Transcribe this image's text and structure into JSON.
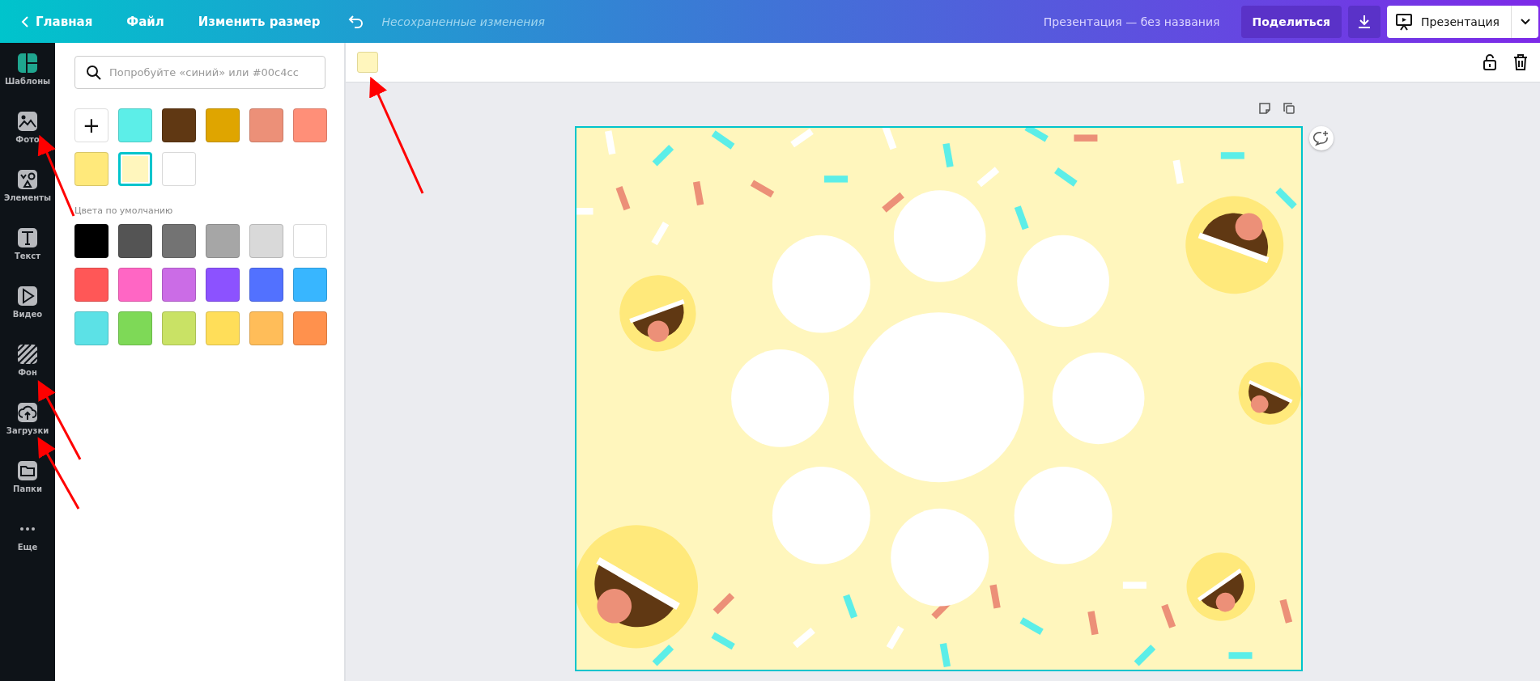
{
  "topbar": {
    "nav": [
      {
        "label": "Главная",
        "kind": "back"
      },
      {
        "label": "Файл",
        "kind": "menu"
      },
      {
        "label": "Изменить размер",
        "kind": "menu"
      }
    ],
    "status": "Несохраненные изменения",
    "title": "Презентация — без названия",
    "share": "Поделиться",
    "present": "Презентация"
  },
  "sidebar": {
    "items": [
      {
        "label": "Шаблоны",
        "kind": "templates"
      },
      {
        "label": "Фото",
        "kind": "photo"
      },
      {
        "label": "Элементы",
        "kind": "elements"
      },
      {
        "label": "Текст",
        "kind": "text"
      },
      {
        "label": "Видео",
        "kind": "video"
      },
      {
        "label": "Фон",
        "kind": "background"
      },
      {
        "label": "Загрузки",
        "kind": "uploads"
      },
      {
        "label": "Папки",
        "kind": "folders"
      },
      {
        "label": "Еще",
        "kind": "more"
      }
    ]
  },
  "panel": {
    "search": {
      "placeholder": "Попробуйте «синий» или #00c4cc"
    },
    "add_label": "+",
    "document_colors": [
      {
        "color": "#5ceee8",
        "selected": false
      },
      {
        "color": "#603813",
        "selected": false
      },
      {
        "color": "#dfa500",
        "selected": false
      },
      {
        "color": "#ec9078",
        "selected": false
      },
      {
        "color": "#ff8f78",
        "selected": false
      },
      {
        "color": "#ffe97b",
        "selected": false
      },
      {
        "color": "#fff6bd",
        "selected": true
      },
      {
        "color": "#ffffff",
        "selected": false
      }
    ],
    "default_title": "Цвета по умолчанию",
    "default_colors": [
      {
        "color": "#000000"
      },
      {
        "color": "#545454"
      },
      {
        "color": "#737373"
      },
      {
        "color": "#a6a6a6"
      },
      {
        "color": "#d9d9d9"
      },
      {
        "color": "#ffffff"
      },
      {
        "color": "#ff5757"
      },
      {
        "color": "#ff66c4"
      },
      {
        "color": "#cb6ce6"
      },
      {
        "color": "#8c52ff"
      },
      {
        "color": "#5271ff"
      },
      {
        "color": "#38b6ff"
      },
      {
        "color": "#5ce1e6"
      },
      {
        "color": "#7ed957"
      },
      {
        "color": "#c9e265"
      },
      {
        "color": "#ffde59"
      },
      {
        "color": "#ffbd59"
      },
      {
        "color": "#ff914d"
      }
    ]
  },
  "toolbar": {
    "current_swatch": {
      "color": "#fff6bd"
    }
  },
  "design": {
    "selected": true,
    "color": "#fff6bd"
  }
}
